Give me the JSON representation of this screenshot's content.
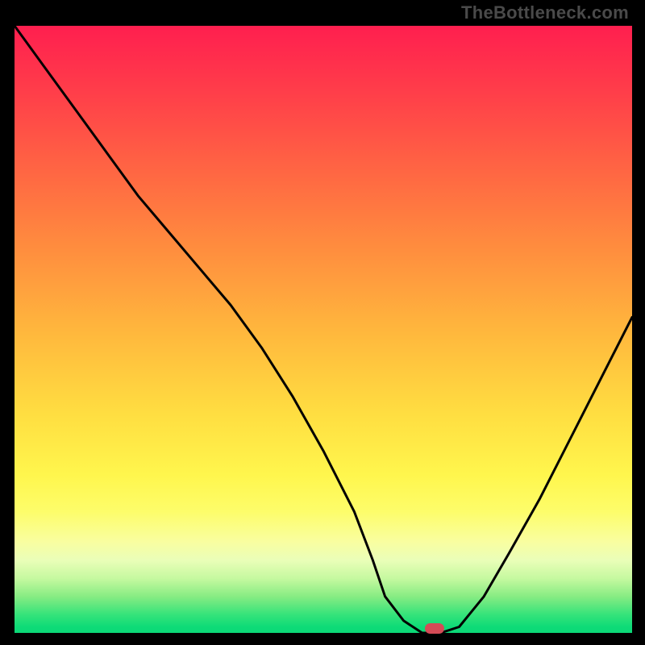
{
  "watermark": "TheBottleneck.com",
  "chart_data": {
    "type": "line",
    "title": "",
    "xlabel": "",
    "ylabel": "",
    "xlim": [
      0,
      100
    ],
    "ylim": [
      0,
      100
    ],
    "x": [
      0,
      5,
      10,
      15,
      20,
      25,
      30,
      35,
      40,
      45,
      50,
      55,
      58,
      60,
      63,
      66,
      69,
      72,
      76,
      80,
      85,
      90,
      95,
      100
    ],
    "values": [
      100,
      93,
      86,
      79,
      72,
      66,
      60,
      54,
      47,
      39,
      30,
      20,
      12,
      6,
      2,
      0,
      0,
      1,
      6,
      13,
      22,
      32,
      42,
      52
    ],
    "marker_x": 68,
    "marker_y": 0
  },
  "colors": {
    "curve": "#000000",
    "marker": "#d44b56",
    "watermark": "#4a4a4a"
  }
}
